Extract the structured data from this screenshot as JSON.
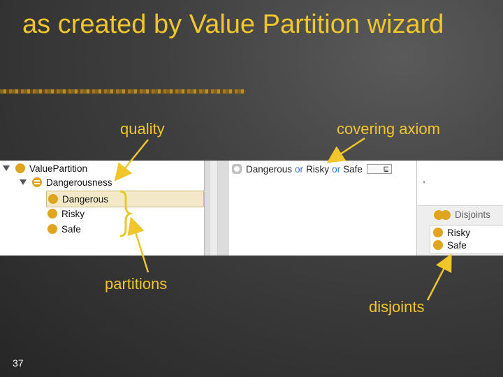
{
  "slide": {
    "title": "as created by Value Partition wizard",
    "page_number": "37",
    "accent_color": "#f0c62a"
  },
  "labels": {
    "quality": "quality",
    "covering_axiom": "covering axiom",
    "partitions": "partitions",
    "disjoints": "disjoints"
  },
  "tree": {
    "root": "ValuePartition",
    "quality": "Dangerousness",
    "items": [
      "Dangerous",
      "Risky",
      "Safe"
    ],
    "selected": "Dangerous"
  },
  "axiom": {
    "terms": [
      "Dangerous",
      "Risky",
      "Safe"
    ],
    "operator": "or",
    "relation_symbol": "⊑"
  },
  "disjoints_panel": {
    "header": "Disjoints",
    "items": [
      "Risky",
      "Safe"
    ],
    "separator": ","
  }
}
